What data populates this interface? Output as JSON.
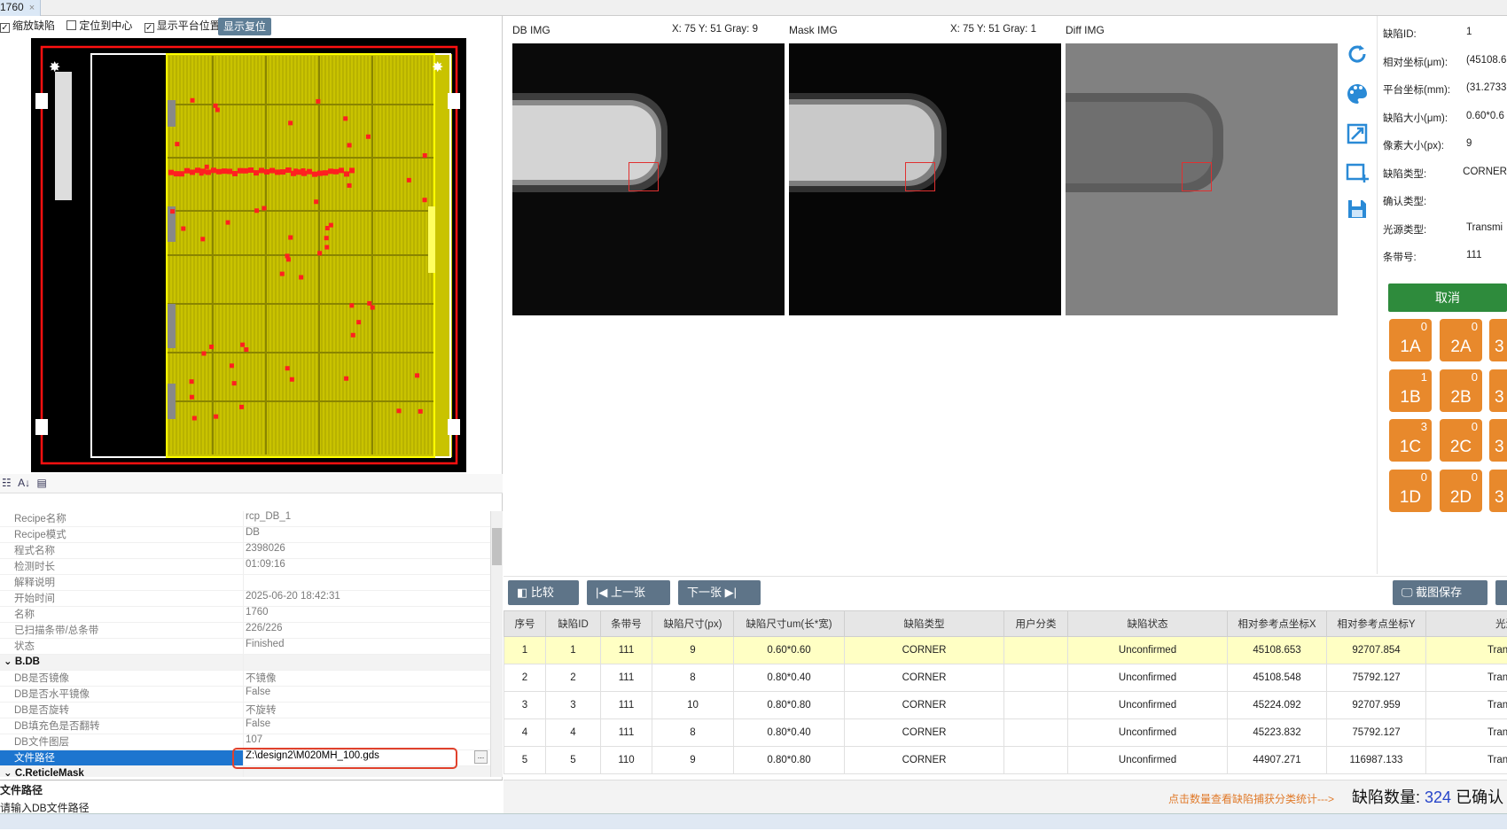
{
  "tab": {
    "title": "1760",
    "close": "×"
  },
  "toolbar": {
    "zoom_defect": {
      "label": "缩放缺陷",
      "checked": true
    },
    "locate_center": {
      "label": "定位到中心",
      "checked": false
    },
    "show_stage": {
      "label": "显示平台位置",
      "checked": true
    },
    "reset_button": "显示复位"
  },
  "properties": {
    "rows": [
      {
        "k": "Recipe名称",
        "v": "rcp_DB_1"
      },
      {
        "k": "Recipe模式",
        "v": "DB"
      },
      {
        "k": "程式名称",
        "v": "2398026"
      },
      {
        "k": "检测时长",
        "v": "01:09:16"
      },
      {
        "k": "解释说明",
        "v": ""
      },
      {
        "k": "开始时间",
        "v": "2025-06-20 18:42:31"
      },
      {
        "k": "名称",
        "v": "1760"
      },
      {
        "k": "已扫描条带/总条带",
        "v": "226/226"
      },
      {
        "k": "状态",
        "v": "Finished"
      }
    ],
    "category_b": "B.DB",
    "rows_b": [
      {
        "k": "DB是否镜像",
        "v": "不镜像"
      },
      {
        "k": "DB是否水平镜像",
        "v": "False"
      },
      {
        "k": "DB是否旋转",
        "v": "不旋转"
      },
      {
        "k": "DB填充色是否翻转",
        "v": "False"
      },
      {
        "k": "DB文件图层",
        "v": "107"
      },
      {
        "k": "文件路径",
        "v": "Z:\\design2\\M020MH_100.gds"
      }
    ],
    "category_c": "C.ReticleMask",
    "dots": "..."
  },
  "description": {
    "title": "文件路径",
    "text": "请输入DB文件路径"
  },
  "images": {
    "db": {
      "label": "DB IMG",
      "coord": "X:  75 Y:  51 Gray:   9"
    },
    "mask": {
      "label": "Mask IMG",
      "coord": "X:  75 Y:  51 Gray:   1"
    },
    "diff": {
      "label": "Diff IMG"
    }
  },
  "side_icons": [
    "refresh-icon",
    "palette-icon",
    "expand-icon",
    "add-region-icon",
    "save-icon"
  ],
  "defect_info": [
    {
      "k": "缺陷ID:",
      "v": "1"
    },
    {
      "k": "相对坐标(μm):",
      "v": "(45108.6"
    },
    {
      "k": "平台坐标(mm):",
      "v": "(31.2733"
    },
    {
      "k": "缺陷大小(μm):",
      "v": "0.60*0.6"
    },
    {
      "k": "像素大小(px):",
      "v": "9"
    },
    {
      "k": "缺陷类型:",
      "v": "CORNER"
    },
    {
      "k": "确认类型:",
      "v": ""
    },
    {
      "k": "光源类型:",
      "v": "Transmi"
    },
    {
      "k": "条带号:",
      "v": "111"
    }
  ],
  "cancel_button": "取消",
  "class_buttons": [
    {
      "label": "1A",
      "count": "0"
    },
    {
      "label": "2A",
      "count": "0"
    },
    {
      "label": "3",
      "count": ""
    },
    {
      "label": "1B",
      "count": "1"
    },
    {
      "label": "2B",
      "count": "0"
    },
    {
      "label": "3",
      "count": ""
    },
    {
      "label": "1C",
      "count": "3"
    },
    {
      "label": "2C",
      "count": "0"
    },
    {
      "label": "3",
      "count": ""
    },
    {
      "label": "1D",
      "count": "0"
    },
    {
      "label": "2D",
      "count": "0"
    },
    {
      "label": "3",
      "count": ""
    }
  ],
  "nav": {
    "compare": "比较",
    "prev": "上一张",
    "next": "下一张",
    "screenshot": "截图保存"
  },
  "table": {
    "headers": [
      "序号",
      "缺陷ID",
      "条带号",
      "缺陷尺寸(px)",
      "缺陷尺寸um(长*宽)",
      "缺陷类型",
      "用户分类",
      "缺陷状态",
      "相对参考点坐标X",
      "相对参考点坐标Y",
      "光源"
    ],
    "rows": [
      [
        "1",
        "1",
        "111",
        "9",
        "0.60*0.60",
        "CORNER",
        "",
        "Unconfirmed",
        "45108.653",
        "92707.854",
        "Transmi"
      ],
      [
        "2",
        "2",
        "111",
        "8",
        "0.80*0.40",
        "CORNER",
        "",
        "Unconfirmed",
        "45108.548",
        "75792.127",
        "Transmi"
      ],
      [
        "3",
        "3",
        "111",
        "10",
        "0.80*0.80",
        "CORNER",
        "",
        "Unconfirmed",
        "45224.092",
        "92707.959",
        "Transmi"
      ],
      [
        "4",
        "4",
        "111",
        "8",
        "0.80*0.40",
        "CORNER",
        "",
        "Unconfirmed",
        "45223.832",
        "75792.127",
        "Transmi"
      ],
      [
        "5",
        "5",
        "110",
        "9",
        "0.80*0.80",
        "CORNER",
        "",
        "Unconfirmed",
        "44907.271",
        "116987.133",
        "Transmi"
      ]
    ]
  },
  "footer": {
    "hint": "点击数量查看缺陷捕获分类统计--->",
    "count_label": "缺陷数量:",
    "count": "324",
    "confirmed_label": "已确认"
  },
  "colors": {
    "accent_orange": "#e8892c",
    "accent_green": "#2e8b3c",
    "selection_blue": "#1d75cf",
    "highlight_row": "#ffffc4",
    "mark_red": "#e03030"
  }
}
